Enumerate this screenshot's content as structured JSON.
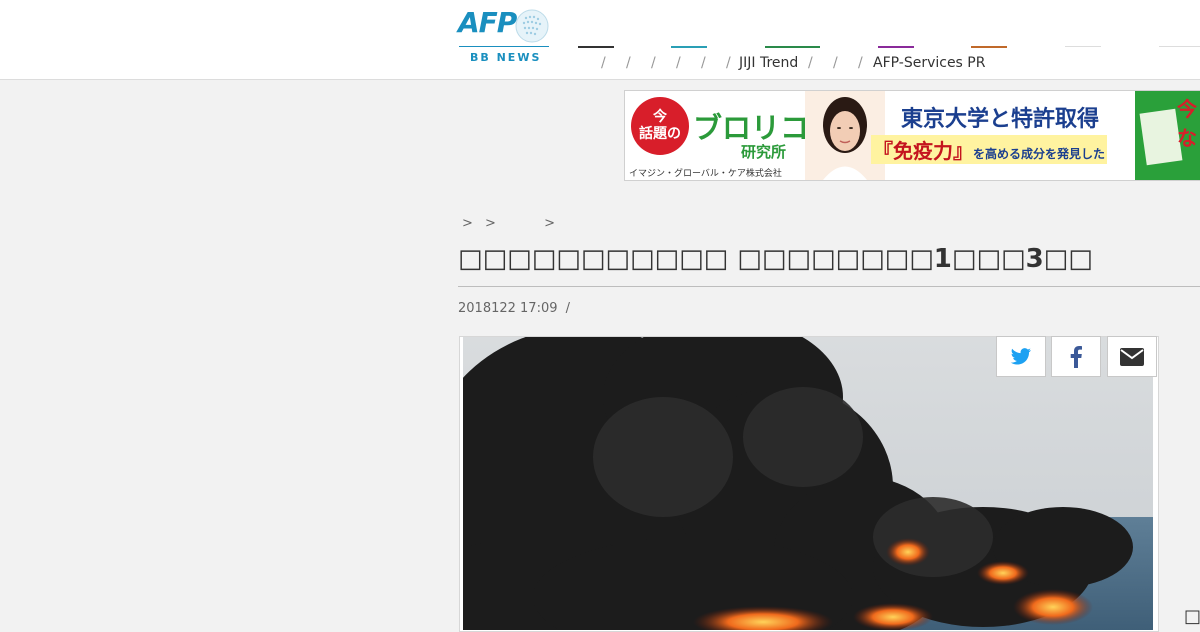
{
  "header": {
    "logo": {
      "brand": "AFP",
      "sub": "BB NEWS"
    },
    "nav": {
      "slashes": [
        "/",
        "/",
        "/",
        "/",
        "/",
        "/",
        "/",
        "/",
        "/"
      ],
      "labels": [
        "JIJI Trend",
        "AFP-Services PR"
      ],
      "accent_colors": [
        "#333333",
        "#2a9fb5",
        "#2a8a4a",
        "#8a2a9a",
        "#c0692a",
        "#dddddd",
        "#dddddd"
      ]
    }
  },
  "ad": {
    "badge_top": "今",
    "badge_bottom": "話題の",
    "brand": "ブロリコ",
    "brand_sub": "研究所",
    "company": "イマジン・グローバル・ケア株式会社",
    "headline": "東京大学と特許取得",
    "highlight": "『免疫力』",
    "highlight_rest": "を高める成分を発見した",
    "book_text": "今な"
  },
  "article": {
    "breadcrumb": [
      ">",
      ">",
      ">"
    ],
    "title": "□□□□□□□□□□□ □□□□□□□□1□□□3□□",
    "date": "2018122 17:09",
    "date_sep": "/"
  },
  "share": {
    "twitter_icon": "twitter-icon",
    "facebook_icon": "facebook-icon",
    "mail_icon": "mail-icon"
  },
  "corner_glyph": "□",
  "colors": {
    "afp_blue": "#1a8fbf",
    "ad_green": "#2b9a3a",
    "ad_red": "#d81e2a",
    "ad_navy": "#1b3f8f",
    "twitter": "#1da1f2",
    "facebook": "#3b5998"
  }
}
